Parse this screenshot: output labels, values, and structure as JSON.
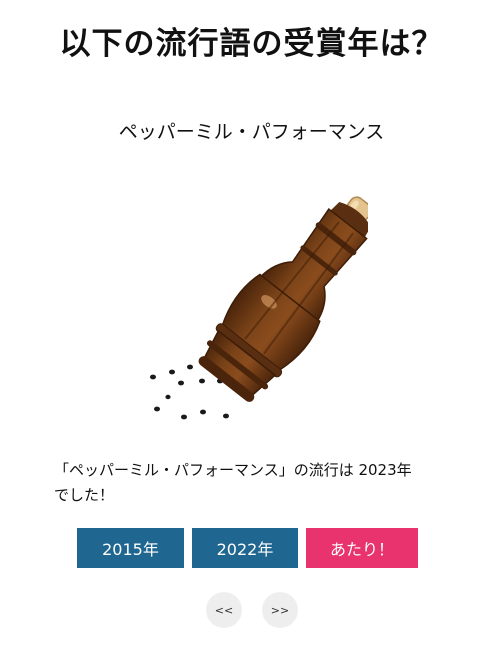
{
  "quiz": {
    "title": "以下の流行語の受賞年は？",
    "term": "ペッパーミル・パフォーマンス",
    "answer_line1": "「ペッパーミル・パフォーマンス」の流行は 2023年",
    "answer_line2": "でした！"
  },
  "illustration": {
    "icon": "pepper-mill-icon"
  },
  "choices": [
    {
      "label": "2015年",
      "color": "#1f6790"
    },
    {
      "label": "2022年",
      "color": "#1f6790"
    },
    {
      "label": "あたり！",
      "color": "#e8336f"
    }
  ],
  "nav": {
    "prev_label": "<<",
    "next_label": ">>"
  },
  "colors": {
    "wood_dark": "#5a2e10",
    "wood_mid": "#7a4318",
    "cap": "#e3c490"
  }
}
